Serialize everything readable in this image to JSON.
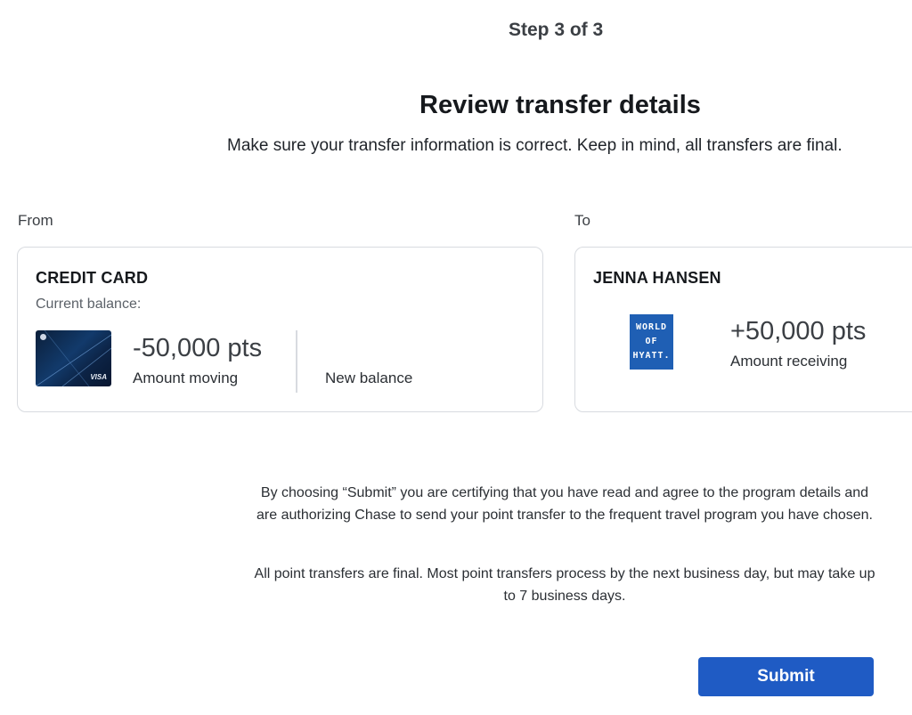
{
  "header": {
    "step": "Step 3 of 3",
    "title": "Review transfer details",
    "subtitle": "Make sure your transfer information is correct. Keep in mind, all transfers are final."
  },
  "from": {
    "section_label": "From",
    "card_title": "CREDIT CARD",
    "balance_label": "Current balance:",
    "card_icon": "credit-card-image",
    "card_brand": "VISA",
    "amount": "-50,000 pts",
    "amount_label": "Amount moving",
    "new_balance_label": "New balance"
  },
  "to": {
    "section_label": "To",
    "recipient": "JENNA HANSEN",
    "program_logo": "world-of-hyatt-logo",
    "program_logo_lines": [
      "WORLD",
      "OF",
      "HYATT."
    ],
    "amount": "+50,000 pts",
    "amount_label": "Amount receiving"
  },
  "disclaimer": {
    "certify": "By choosing “Submit” you are certifying that you have read and agree to the program details and are authorizing Chase to send your point transfer to the frequent travel program you have chosen.",
    "final": "All point transfers are final. Most point transfers process by the next business day, but may take up to 7 business days."
  },
  "actions": {
    "submit_label": "Submit"
  },
  "colors": {
    "primary": "#1f5bc4",
    "hyatt_blue": "#1f5fb4",
    "card_border": "#d8dbe0"
  }
}
